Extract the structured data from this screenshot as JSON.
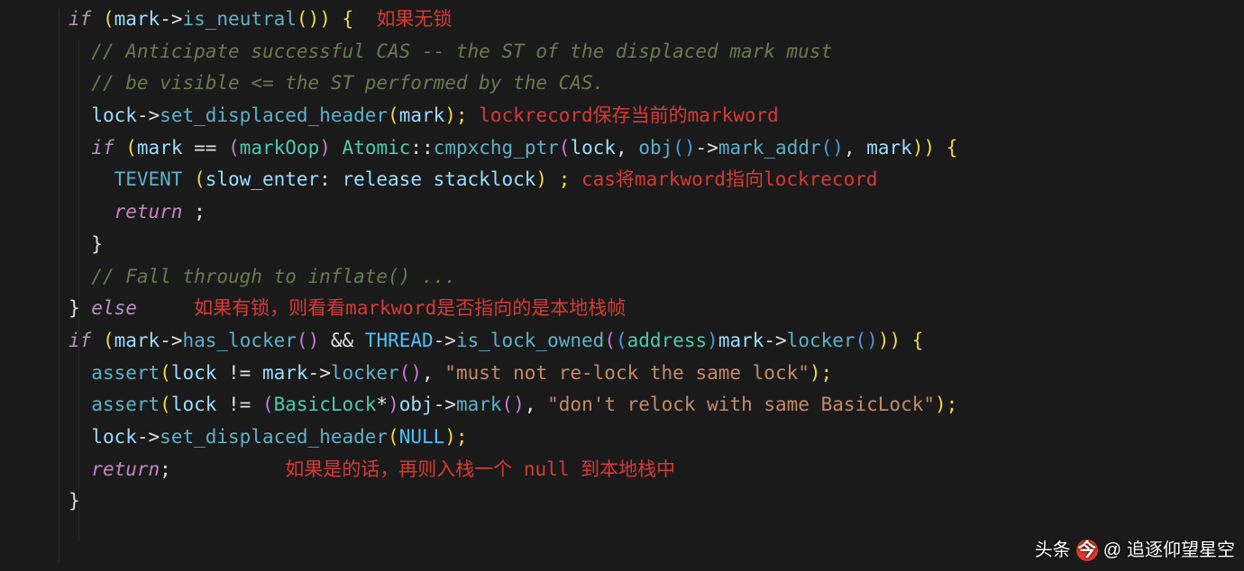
{
  "code": {
    "l1": {
      "kw": "if",
      "paren_open": "(",
      "id1": "mark",
      "arrow": "->",
      "fn": "is_neutral",
      "paren_close": "()) {",
      "ann": "如果无锁"
    },
    "l2": {
      "cmt": "// Anticipate successful CAS -- the ST of the displaced mark must"
    },
    "l3": {
      "cmt": "// be visible <= the ST performed by the CAS."
    },
    "l4": {
      "id1": "lock",
      "arrow": "->",
      "fn": "set_displaced_header",
      "paren": "(",
      "arg": "mark",
      "close": ");",
      "ann": "lockrecord保存当前的markword"
    },
    "l5": {
      "kw": "if",
      "po": "(",
      "id1": "mark",
      "eq": " == ",
      "pp": "(",
      "ty": "markOop",
      "pc": ")",
      "cls": "Atomic",
      "dcol": "::",
      "fn": "cmpxchg_ptr",
      "po2": "(",
      "a1": "lock",
      "c1": ", ",
      "a2": "obj",
      "p_inner": "()",
      "arrow": "->",
      "fn2": "mark_addr",
      "p_inner2": "()",
      "c2": ", ",
      "a3": "mark",
      "close": ")) {"
    },
    "l6": {
      "fn": "TEVENT",
      "po": " (",
      "a1": "slow_enter",
      "c": ": ",
      "a2": "release stacklock",
      "close": ") ;",
      "ann": "cas将markword指向lockrecord"
    },
    "l7": {
      "kw": "return",
      "semi": " ;"
    },
    "l8": {
      "brace": "}"
    },
    "l9": {
      "cmt": "// Fall through to inflate() ..."
    },
    "l10": {
      "brace": "}",
      "kw": " else",
      "ann": "如果有锁，则看看markword是否指向的是本地栈帧"
    },
    "l11": {
      "kw": "if",
      "po": "(",
      "id1": "mark",
      "arrow": "->",
      "fn1": "has_locker",
      "p1": "()",
      "op": " && ",
      "id2": "THREAD",
      "arrow2": "->",
      "fn2": "is_lock_owned",
      "po2": "(",
      "po3": "(",
      "ty": "address",
      "pc3": ")",
      "id3": "mark",
      "arrow3": "->",
      "fn3": "locker",
      "p3": "()",
      "close": ")) {"
    },
    "l12": {
      "fn": "assert",
      "po": "(",
      "a1": "lock",
      "op": " != ",
      "a2": "mark",
      "arrow": "->",
      "fn2": "locker",
      "p": "()",
      "c": ", ",
      "str": "\"must not re-lock the same lock\"",
      "close": ");"
    },
    "l13": {
      "fn": "assert",
      "po": "(",
      "a1": "lock",
      "op": " != ",
      "po2": "(",
      "ty": "BasicLock",
      "star": "*",
      "pc2": ")",
      "a2": "obj",
      "arrow": "->",
      "fn2": "mark",
      "p": "()",
      "c": ", ",
      "str": "\"don't relock with same BasicLock\"",
      "close": ");"
    },
    "l14": {
      "id1": "lock",
      "arrow": "->",
      "fn": "set_displaced_header",
      "po": "(",
      "arg": "NULL",
      "close": ");"
    },
    "l15": {
      "kw": "return",
      "semi": ";",
      "ann": "如果是的话，再则入栈一个 null 到本地栈中"
    },
    "l16": {
      "brace": "}"
    }
  },
  "watermark": {
    "prefix": "头条",
    "at": "@",
    "name": "追逐仰望星空"
  }
}
